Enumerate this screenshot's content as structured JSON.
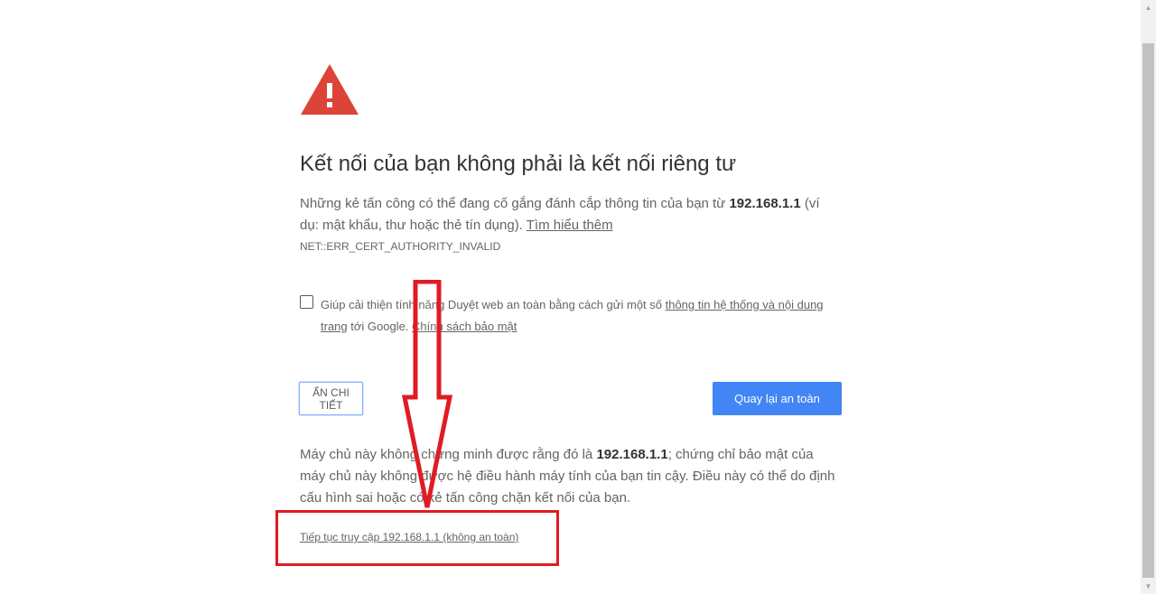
{
  "icons": {
    "warning": "warning-triangle-icon",
    "arrow": "red-down-arrow",
    "checkbox": "checkbox"
  },
  "colors": {
    "warning_red": "#db4437",
    "primary_blue": "#4285f4",
    "annotation_red": "#e01b24"
  },
  "heading": "Kết nối của bạn không phải là kết nối riêng tư",
  "explanation": {
    "before_host": "Những kẻ tấn công có thể đang cố gắng đánh cắp thông tin của bạn từ ",
    "host": "192.168.1.1",
    "after_host": " (ví dụ: mật khẩu, thư hoặc thẻ tín dụng). ",
    "learn_more": "Tìm hiểu thêm"
  },
  "error_code": "NET::ERR_CERT_AUTHORITY_INVALID",
  "safe_browsing": {
    "text_before": "Giúp cải thiện tính năng Duyệt web an toàn bằng cách gửi một số ",
    "link_info": "thông tin hệ thống và nội dung trang",
    "text_middle": " tới Google. ",
    "link_privacy": "Chính sách bảo mật"
  },
  "buttons": {
    "details": "ẨN CHI TIẾT",
    "back_to_safety": "Quay lại an toàn"
  },
  "details": {
    "before_host": "Máy chủ này không chứng minh được rằng đó là ",
    "host": "192.168.1.1",
    "after_host": "; chứng chỉ bảo mật của máy chủ này không được hệ điều hành máy tính của bạn tin cậy. Điều này có thể do định cấu hình sai hoặc có kẻ tấn công chặn kết nối của bạn."
  },
  "proceed_link": "Tiếp tục truy cập 192.168.1.1 (không an toàn)"
}
